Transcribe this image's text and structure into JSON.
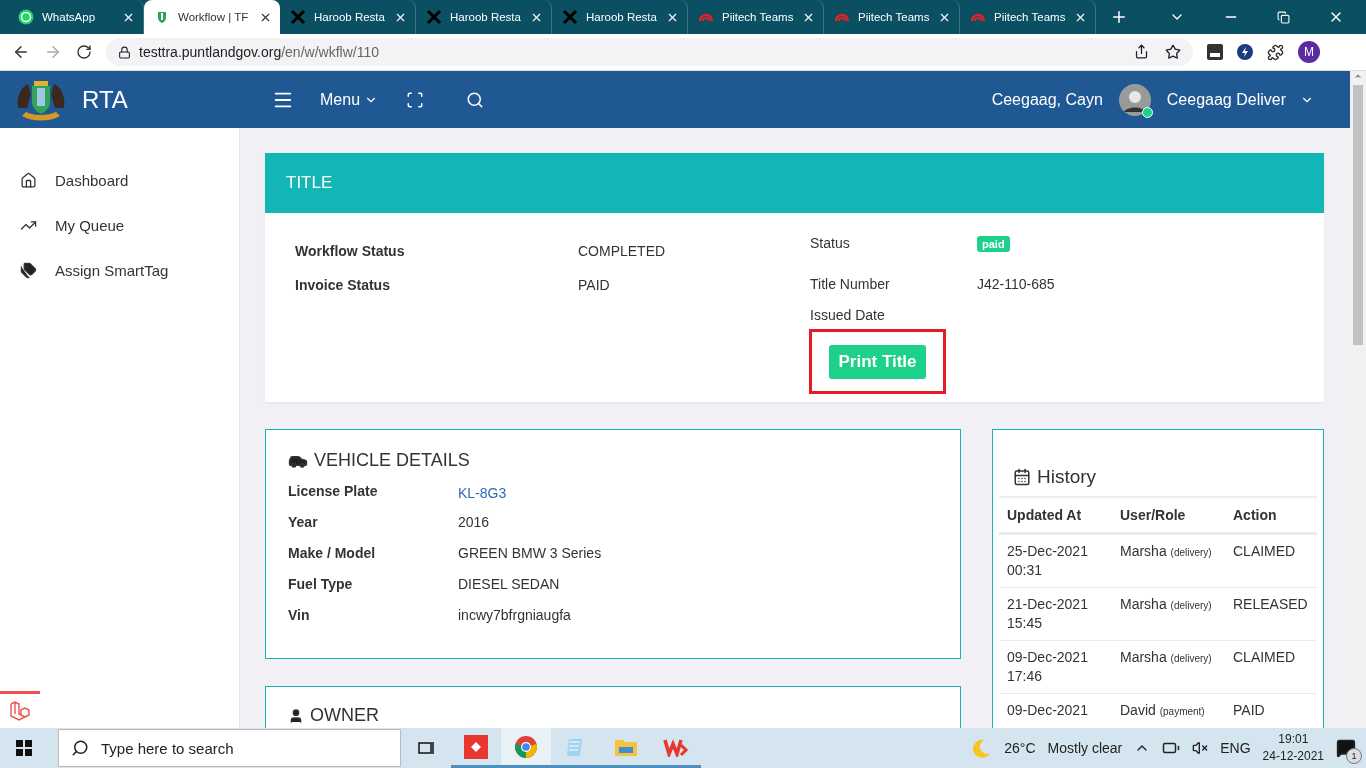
{
  "browser": {
    "tabs": [
      {
        "title": "WhatsApp",
        "kind": "whatsapp",
        "selected": false
      },
      {
        "title": "Workflow | TF",
        "kind": "crest",
        "selected": true
      },
      {
        "title": "Haroob Resta",
        "kind": "cross",
        "selected": false
      },
      {
        "title": "Haroob Resta",
        "kind": "cross",
        "selected": false
      },
      {
        "title": "Haroob Resta",
        "kind": "cross",
        "selected": false
      },
      {
        "title": "Piitech Teams",
        "kind": "arc",
        "selected": false
      },
      {
        "title": "Piitech Teams",
        "kind": "arc",
        "selected": false
      },
      {
        "title": "Piitech Teams",
        "kind": "arc",
        "selected": false
      }
    ],
    "url_host": "testtra.puntlandgov.org",
    "url_path": "/en/w/wkflw/110",
    "profile_initial": "M"
  },
  "header": {
    "logo_text": "RTA",
    "menu": "Menu",
    "user_name": "Ceegaag, Cayn",
    "account": "Ceegaag Deliver",
    "online": true
  },
  "sidebar": {
    "items": [
      {
        "label": "Dashboard",
        "kind": "home"
      },
      {
        "label": "My Queue",
        "kind": "trend"
      },
      {
        "label": "Assign SmartTag",
        "kind": "tags"
      }
    ]
  },
  "title_card": {
    "heading": "TITLE",
    "left": [
      {
        "label": "Workflow Status",
        "value": "COMPLETED"
      },
      {
        "label": "Invoice Status",
        "value": "PAID"
      }
    ],
    "status_label": "Status",
    "status_badge": "paid",
    "title_number_label": "Title Number",
    "title_number": "J42-110-685",
    "issued_label": "Issued Date",
    "print_button": "Print Title",
    "highlighted": true
  },
  "vehicle": {
    "heading": "VEHICLE DETAILS",
    "rows": [
      {
        "label": "License Plate",
        "value": "KL-8G3",
        "link": true
      },
      {
        "label": "Year",
        "value": "2016",
        "link": false
      },
      {
        "label": "Make / Model",
        "value": "GREEN BMW 3 Series",
        "link": false
      },
      {
        "label": "Fuel Type",
        "value": "DIESEL SEDAN",
        "link": false
      },
      {
        "label": "Vin",
        "value": "incwy7bfrgniaugfa",
        "link": false
      }
    ]
  },
  "owner": {
    "heading": "OWNER"
  },
  "history": {
    "heading": "History",
    "columns": [
      "Updated At",
      "User/Role",
      "Action"
    ],
    "rows": [
      {
        "date": "25-Dec-2021",
        "time": "00:31",
        "user": "Marsha",
        "role": "(delivery)",
        "action": "CLAIMED"
      },
      {
        "date": "21-Dec-2021",
        "time": "15:45",
        "user": "Marsha",
        "role": "(delivery)",
        "action": "RELEASED"
      },
      {
        "date": "09-Dec-2021",
        "time": "17:46",
        "user": "Marsha",
        "role": "(delivery)",
        "action": "CLAIMED"
      },
      {
        "date": "09-Dec-2021",
        "user": "David",
        "role": "(payment)",
        "action": "PAID"
      }
    ]
  },
  "taskbar": {
    "search_placeholder": "Type here to search",
    "temperature": "26°C",
    "weather": "Mostly clear",
    "language": "ENG",
    "time": "19:01",
    "date": "24-12-2021",
    "notifications": "1"
  }
}
